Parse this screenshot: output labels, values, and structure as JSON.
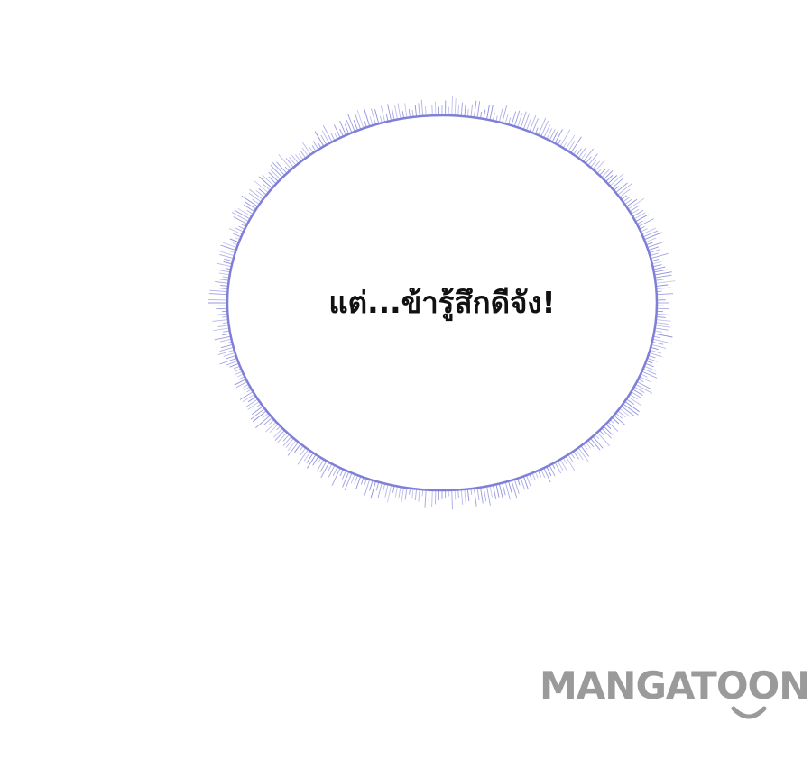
{
  "speech_bubble": {
    "text": "แต่...ข้ารู้สึกดีจัง!",
    "outline_color": "#7f7fd8",
    "fill_color": "#ffffff"
  },
  "watermark": {
    "brand": "MANGATOON",
    "color": "#9a9a9a",
    "icon": "smile-icon"
  }
}
